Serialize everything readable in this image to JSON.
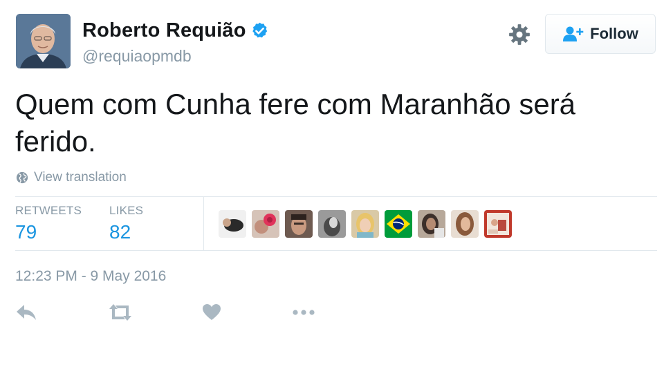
{
  "user": {
    "display_name": "Roberto Requião",
    "handle": "@requiaopmdb",
    "verified": true
  },
  "header": {
    "follow_label": "Follow",
    "settings_icon": "gear-icon"
  },
  "tweet": {
    "text": "Quem com Cunha fere com Maranhão será ferido.",
    "translate_label": "View translation",
    "timestamp": "12:23 PM - 9 May 2016"
  },
  "stats": {
    "retweets_label": "RETWEETS",
    "retweets_count": "79",
    "likes_label": "LIKES",
    "likes_count": "82"
  },
  "likers": [
    {
      "icon": "liker-avatar"
    },
    {
      "icon": "liker-avatar"
    },
    {
      "icon": "liker-avatar"
    },
    {
      "icon": "liker-avatar"
    },
    {
      "icon": "liker-avatar"
    },
    {
      "icon": "brazil-flag-avatar"
    },
    {
      "icon": "liker-avatar"
    },
    {
      "icon": "liker-avatar"
    },
    {
      "icon": "liker-avatar"
    }
  ],
  "actions": [
    "reply-icon",
    "retweet-icon",
    "like-icon",
    "more-icon"
  ],
  "colors": {
    "text": "#14171a",
    "secondary": "#8899a6",
    "link": "#1b95e0",
    "verified": "#1da1f2",
    "border": "#e1e8ed",
    "icon": "#aab8c2"
  }
}
